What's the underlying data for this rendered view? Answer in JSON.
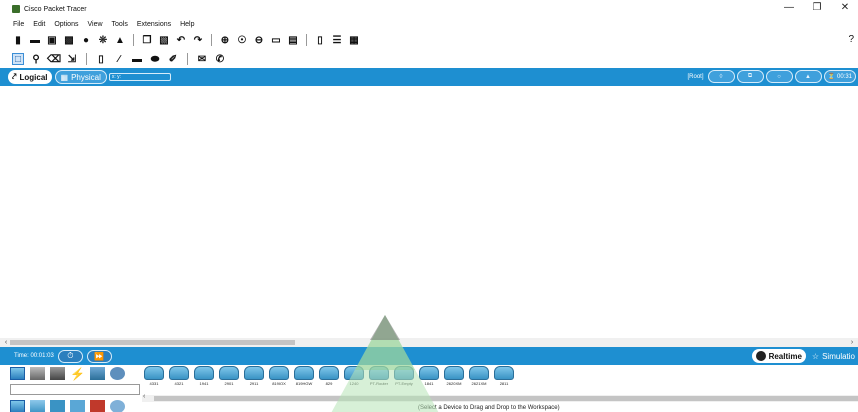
{
  "window": {
    "title": "Cisco Packet Tracer",
    "controls": [
      "minimize",
      "maximize",
      "close"
    ]
  },
  "menu": [
    "File",
    "Edit",
    "Options",
    "View",
    "Tools",
    "Extensions",
    "Help"
  ],
  "toolbar1": [
    "new-file-icon",
    "open-folder-icon",
    "save-icon",
    "print-icon",
    "info-icon",
    "activity-wizard-icon",
    "network-icon",
    "copy-icon",
    "paste-icon",
    "undo-icon",
    "redo-icon",
    "zoom-in-icon",
    "zoom-reset-icon",
    "zoom-out-icon",
    "drawing-palette-icon",
    "custom-device-dialog-icon",
    "device-list-icon",
    "notes-icon",
    "image-icon"
  ],
  "toolbar2": [
    "select-icon",
    "inspect-icon",
    "delete-icon",
    "resize-icon",
    "note-icon",
    "line-icon",
    "rectangle-icon",
    "ellipse-icon",
    "freeform-icon",
    "add-pdu-icon",
    "add-complex-pdu-icon"
  ],
  "help_icon": "?",
  "view": {
    "logical_label": "Logical",
    "physical_label": "Physical",
    "path_field": "x: y:",
    "root_label": "[Root]",
    "clock": "00:31"
  },
  "time": {
    "label": "Time: 00:01:03"
  },
  "modes": {
    "realtime_label": "Realtime",
    "simulation_label": "Simulatio"
  },
  "devices": [
    "4331",
    "4321",
    "1941",
    "2901",
    "2911",
    "819IOX",
    "819HGW",
    "829",
    "1240",
    "PT-Router",
    "PT-Empty",
    "1841",
    "2620XM",
    "2621XM",
    "2811"
  ],
  "hint": "(Select a Device to Drag and Drop to the Workspace)",
  "colors": {
    "accent_bar": "#1e8fd1",
    "device_blue": "#3a93c4"
  }
}
